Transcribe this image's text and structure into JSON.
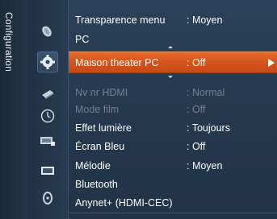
{
  "category": {
    "label": "Configuration",
    "icons": [
      {
        "name": "satellite-dish-icon"
      },
      {
        "name": "gear-icon"
      },
      {
        "name": "remote-control-icon"
      },
      {
        "name": "clock-icon"
      },
      {
        "name": "input-source-icon"
      },
      {
        "name": "screen-icon"
      },
      {
        "name": "support-icon"
      }
    ],
    "active_index": 1
  },
  "menu": {
    "items": [
      {
        "label": "Transparence menu",
        "value": ": Moyen",
        "state": "normal"
      },
      {
        "label": "PC",
        "value": "",
        "state": "normal"
      },
      {
        "label": "Maison theater PC",
        "value": ": Off",
        "state": "selected"
      },
      {
        "label": "Nv nr HDMI",
        "value": ": Normal",
        "state": "disabled"
      },
      {
        "label": "Mode film",
        "value": ": Off",
        "state": "disabled"
      },
      {
        "label": "Effet lumière",
        "value": ": Toujours",
        "state": "normal"
      },
      {
        "label": "Écran Bleu",
        "value": ": Off",
        "state": "normal"
      },
      {
        "label": "Mélodie",
        "value": ": Moyen",
        "state": "normal"
      },
      {
        "label": "Bluetooth",
        "value": "",
        "state": "normal"
      },
      {
        "label": "Anynet+ (HDMI-CEC)",
        "value": "",
        "state": "normal"
      }
    ]
  },
  "colors": {
    "selected": "#d4541b",
    "background": "#2a4159",
    "disabled_text": "#6f8092"
  }
}
